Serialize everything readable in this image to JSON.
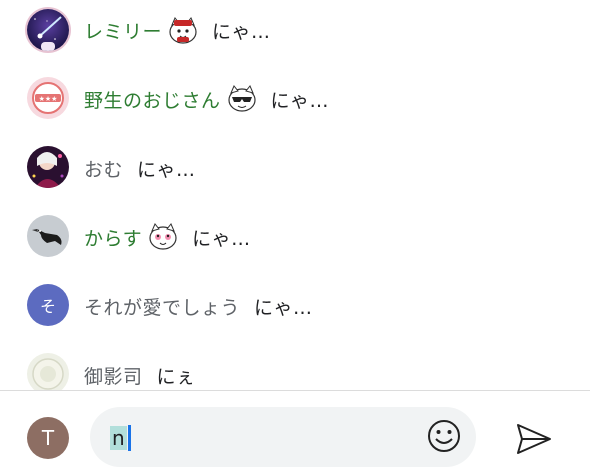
{
  "chats": [
    {
      "name": "レミリー",
      "name_color": "green",
      "has_sticker": true,
      "sticker": "cat-face-sticker",
      "message": "にゃ…"
    },
    {
      "name": "野生のおじさん",
      "name_color": "green",
      "has_sticker": true,
      "sticker": "sunglasses-cat-sticker",
      "message": "にゃ…"
    },
    {
      "name": "おむ",
      "name_color": "gray",
      "has_sticker": false,
      "message": "にゃ…"
    },
    {
      "name": "からす",
      "name_color": "green",
      "has_sticker": true,
      "sticker": "blush-cat-sticker",
      "message": "にゃ…"
    },
    {
      "name": "それが愛でしょう",
      "name_color": "gray",
      "has_sticker": false,
      "message": "にゃ…",
      "avatar_letter": "そ"
    },
    {
      "name": "御影司",
      "name_color": "gray",
      "has_sticker": false,
      "message": "にぇ"
    }
  ],
  "composer": {
    "my_avatar_letter": "T",
    "input_value": "n"
  },
  "colors": {
    "green_name": "#2e7d32",
    "gray_name": "#5f6368",
    "letter_avatar_bg": "#5c6bc0",
    "my_avatar_bg": "#8d6e63"
  }
}
